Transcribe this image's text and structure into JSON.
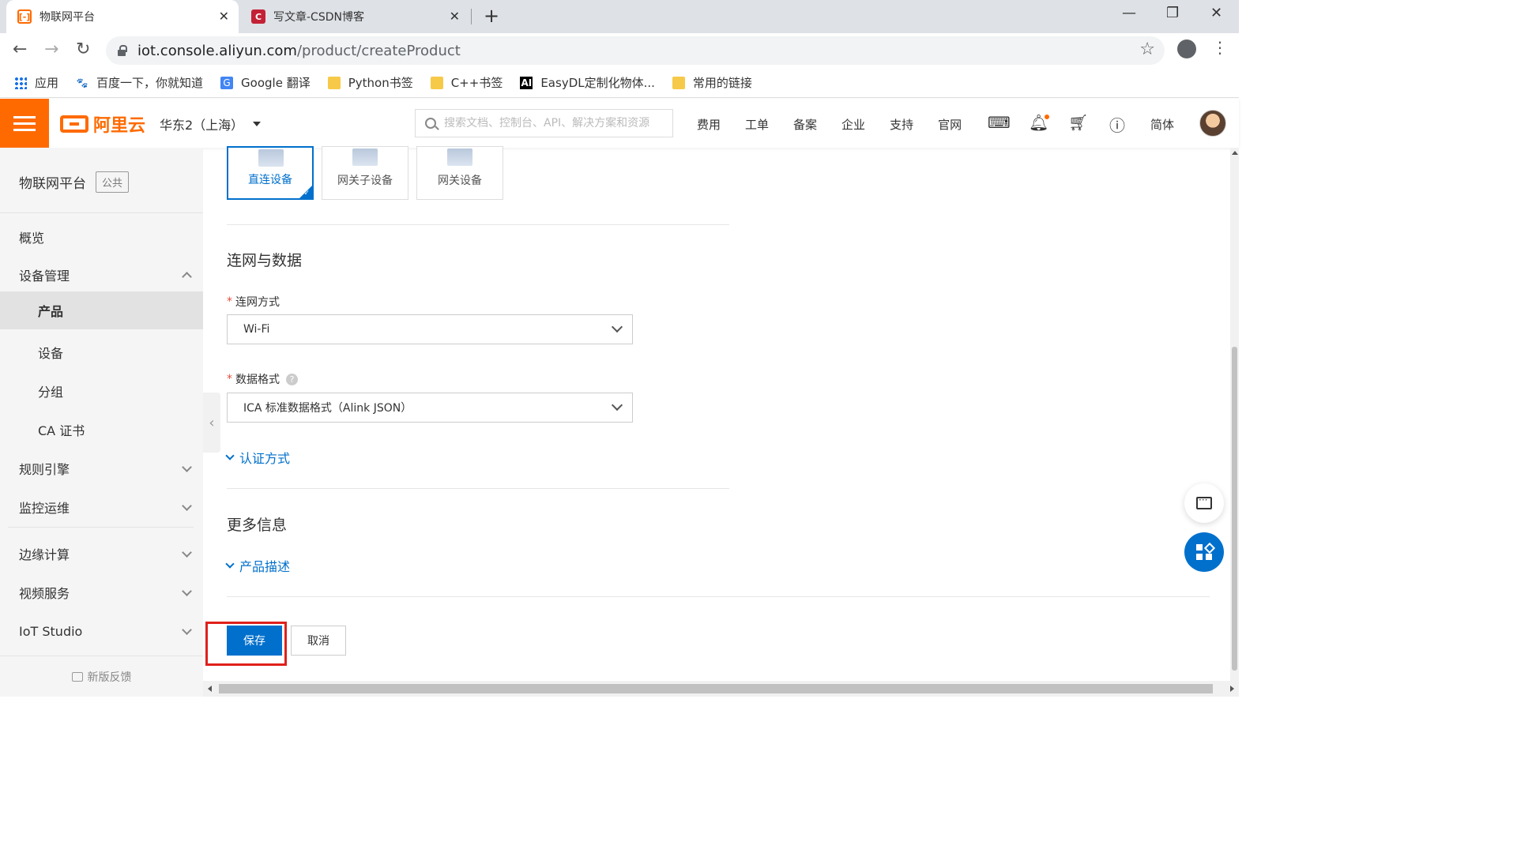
{
  "browser": {
    "tabs": [
      {
        "title": "物联网平台",
        "favicon": "aliyun-icon",
        "active": true
      },
      {
        "title": "写文章-CSDN博客",
        "favicon": "csdn-icon",
        "active": false
      }
    ],
    "url_host": "iot.console.aliyun.com",
    "url_path": "/product/createProduct",
    "bookmarks": [
      {
        "label": "应用",
        "icon": "apps-grid-icon"
      },
      {
        "label": "百度一下，你就知道",
        "icon": "baidu-icon"
      },
      {
        "label": "Google 翻译",
        "icon": "google-translate-icon"
      },
      {
        "label": "Python书签",
        "icon": "folder-icon"
      },
      {
        "label": "C++书签",
        "icon": "folder-icon"
      },
      {
        "label": "EasyDL定制化物体...",
        "icon": "ai-icon"
      },
      {
        "label": "常用的链接",
        "icon": "folder-icon"
      }
    ]
  },
  "header": {
    "logo": "阿里云",
    "region": "华东2（上海）",
    "search_placeholder": "搜索文档、控制台、API、解决方案和资源",
    "links": [
      "费用",
      "工单",
      "备案",
      "企业",
      "支持",
      "官网"
    ],
    "lang": "简体",
    "accent": "#ff6a00"
  },
  "sidebar": {
    "title": "物联网平台",
    "badge": "公共",
    "items": [
      {
        "label": "概览",
        "level": 0
      },
      {
        "label": "设备管理",
        "level": 0,
        "expanded": true
      },
      {
        "label": "产品",
        "level": 1,
        "active": true
      },
      {
        "label": "设备",
        "level": 1
      },
      {
        "label": "分组",
        "level": 1
      },
      {
        "label": "CA 证书",
        "level": 1
      },
      {
        "label": "规则引擎",
        "level": 0
      },
      {
        "label": "监控运维",
        "level": 0
      },
      {
        "label": "边缘计算",
        "level": 0
      },
      {
        "label": "视频服务",
        "level": 0
      },
      {
        "label": "IoT Studio",
        "level": 0
      }
    ],
    "feedback": "新版反馈"
  },
  "form": {
    "node_types": [
      {
        "label": "直连设备",
        "selected": true
      },
      {
        "label": "网关子设备",
        "selected": false
      },
      {
        "label": "网关设备",
        "selected": false
      }
    ],
    "section_network": "连网与数据",
    "network_label": "连网方式",
    "network_value": "Wi-Fi",
    "format_label": "数据格式",
    "format_value": "ICA 标准数据格式（Alink JSON）",
    "auth_expander": "认证方式",
    "section_more": "更多信息",
    "desc_expander": "产品描述",
    "save_label": "保存",
    "cancel_label": "取消",
    "primary_color": "#0070cc"
  }
}
